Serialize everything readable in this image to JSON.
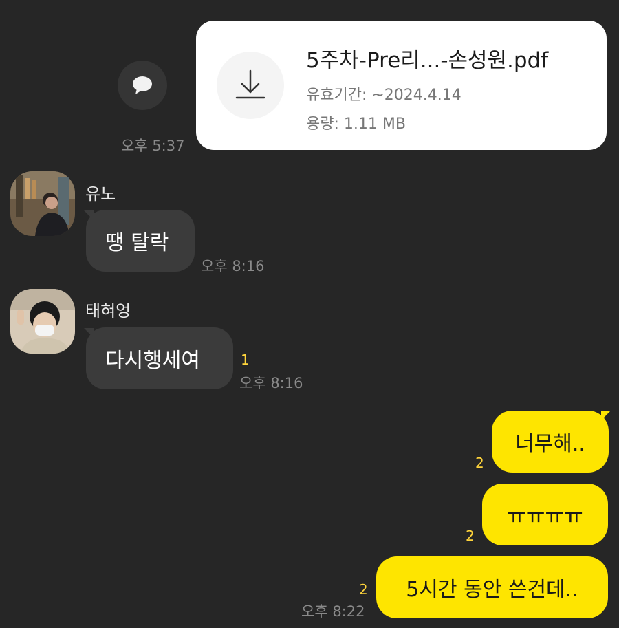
{
  "file_message": {
    "file_name": "5주차-Pre리...-손성원.pdf",
    "expiry": "유효기간: ~2024.4.14",
    "size": "용량: 1.11 MB",
    "time": "오후 5:37",
    "download_icon": "download-icon",
    "share_icon": "speech-bubble-icon"
  },
  "messages": [
    {
      "sender": "유노",
      "text": "땡 탈락",
      "time": "오후 8:16"
    },
    {
      "sender": "태혀엉",
      "text": "다시행세여",
      "time": "오후 8:16",
      "unread": "1"
    }
  ],
  "my_messages": [
    {
      "text": "너무해..",
      "unread": "2"
    },
    {
      "text": "ㅠㅠㅠㅠ",
      "unread": "2"
    },
    {
      "text": "5시간 동안 쓴건데..",
      "unread": "2",
      "time": "오후 8:22"
    }
  ],
  "colors": {
    "background": "#262626",
    "my_bubble": "#fee500",
    "other_bubble": "#3b3b3b",
    "unread": "#ffd43b"
  }
}
